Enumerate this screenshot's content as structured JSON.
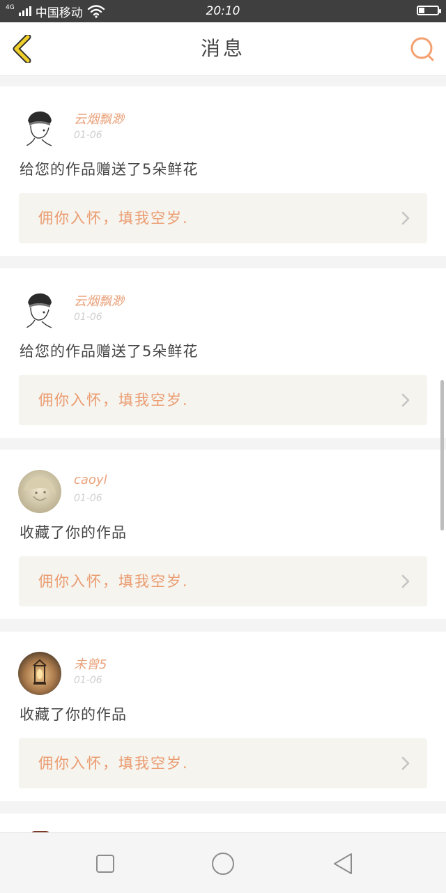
{
  "status_bar": {
    "network_tag": "4G",
    "carrier": "中国移动",
    "time": "20:10",
    "battery_level": 0.3,
    "icons": [
      "signal-icon",
      "wifi-icon",
      "battery-icon"
    ]
  },
  "header": {
    "title": "消息",
    "back_icon": "chevron-left-icon",
    "search_icon": "search-icon"
  },
  "colors": {
    "accent": "#e9a27b",
    "back_icon": "#f0cf2a",
    "search_icon": "#f4a06f",
    "quote_bg": "#f5f4ee",
    "quote_text": "#eb9b70",
    "status_bar": "#3f3f3f"
  },
  "messages": [
    {
      "username": "云烟飘渺",
      "date": "01-06",
      "text": "给您的作品赠送了5朵鲜花",
      "quote": "佣你入怀，填我空岁.",
      "avatar": "cartoon-boy-avatar"
    },
    {
      "username": "云烟飘渺",
      "date": "01-06",
      "text": "给您的作品赠送了5朵鲜花",
      "quote": "佣你入怀，填我空岁.",
      "avatar": "cartoon-boy-avatar"
    },
    {
      "username": "caoyl",
      "date": "01-06",
      "text": "收藏了你的作品",
      "quote": "佣你入怀，填我空岁.",
      "avatar": "anime-portrait-avatar"
    },
    {
      "username": "未曾5",
      "date": "01-06",
      "text": "收藏了你的作品",
      "quote": "佣你入怀，填我空岁.",
      "avatar": "lantern-photo-avatar"
    }
  ],
  "nav_bar": {
    "icons": [
      "recent-apps-icon",
      "home-icon",
      "back-icon"
    ]
  }
}
